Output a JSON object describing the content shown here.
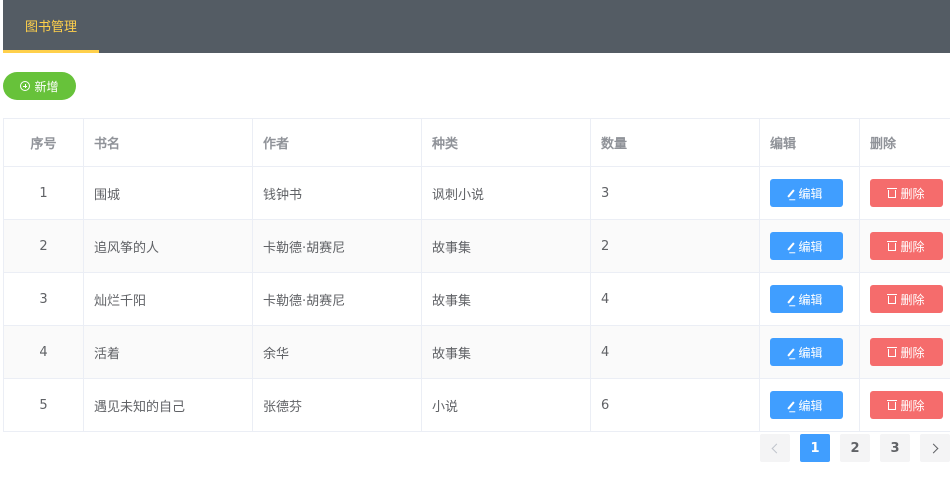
{
  "nav": {
    "tab_label": "图书管理"
  },
  "toolbar": {
    "add_label": "新增"
  },
  "table": {
    "headers": [
      "序号",
      "书名",
      "作者",
      "种类",
      "数量",
      "编辑",
      "删除"
    ],
    "edit_label": "编辑",
    "delete_label": "删除",
    "rows": [
      {
        "index": "1",
        "title": "围城",
        "author": "钱钟书",
        "category": "讽刺小说",
        "quantity": "3"
      },
      {
        "index": "2",
        "title": "追风筝的人",
        "author": "卡勒德·胡赛尼",
        "category": "故事集",
        "quantity": "2"
      },
      {
        "index": "3",
        "title": "灿烂千阳",
        "author": "卡勒德·胡赛尼",
        "category": "故事集",
        "quantity": "4"
      },
      {
        "index": "4",
        "title": "活着",
        "author": "余华",
        "category": "故事集",
        "quantity": "4"
      },
      {
        "index": "5",
        "title": "遇见未知的自己",
        "author": "张德芬",
        "category": "小说",
        "quantity": "6"
      }
    ]
  },
  "pagination": {
    "pages": [
      "1",
      "2",
      "3"
    ],
    "current_page": "1"
  },
  "colors": {
    "nav_bg": "#545c64",
    "nav_active": "#ffd04b",
    "add_button": "#67c23a",
    "edit_button": "#409eff",
    "delete_button": "#f56c6c",
    "active_page": "#409eff"
  },
  "icons": {
    "add": "circle-plus-icon",
    "edit": "pencil-icon",
    "delete": "trash-icon",
    "prev": "chevron-left-icon",
    "next": "chevron-right-icon"
  }
}
